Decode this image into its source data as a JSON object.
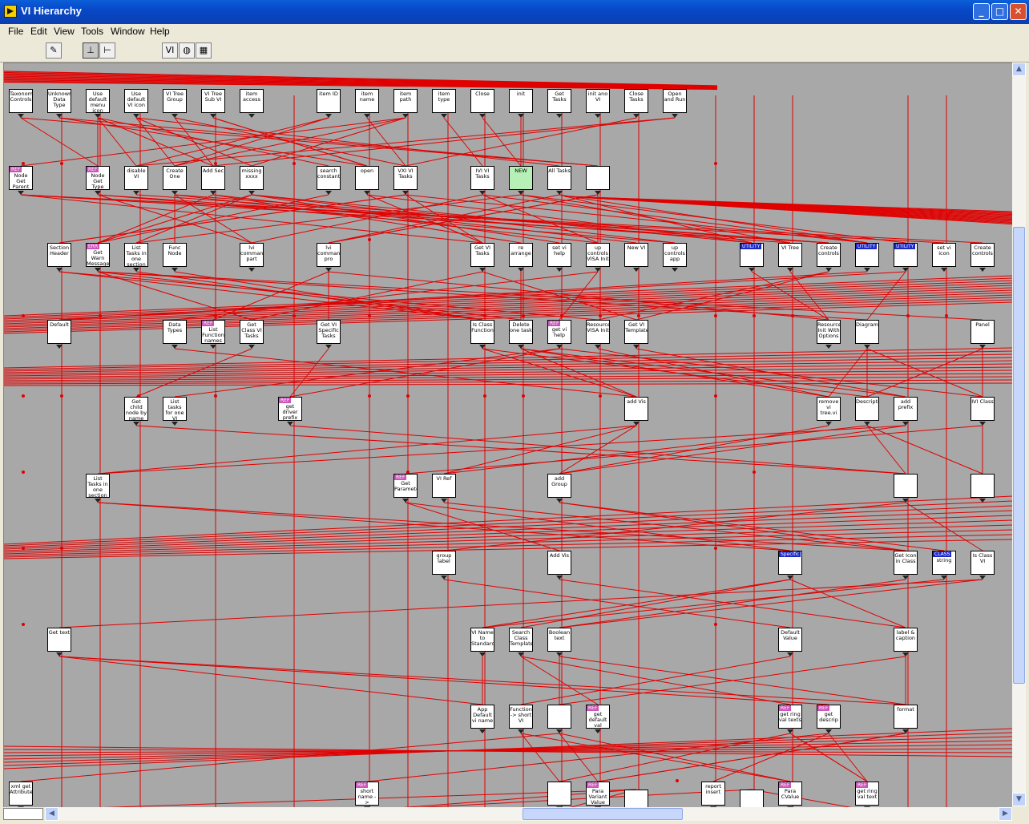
{
  "window": {
    "title": "VI Hierarchy"
  },
  "menu": [
    "File",
    "Edit",
    "View",
    "Tools",
    "Window",
    "Help"
  ],
  "toolbar": [
    {
      "icon": "pencil-icon",
      "glyph": "✎"
    },
    {
      "icon": "vertical-layout-icon",
      "glyph": "⊥"
    },
    {
      "icon": "horizontal-layout-icon",
      "glyph": "⊢"
    },
    {
      "icon": "vi-lib-icon",
      "glyph": "VI"
    },
    {
      "icon": "globe-icon",
      "glyph": "◍"
    },
    {
      "icon": "typedef-icon",
      "glyph": "▦"
    }
  ],
  "colors": {
    "wire": "#e00000",
    "canvas": "#a8a8a8"
  },
  "nodes": [
    {
      "label": "Taxonomy Controls"
    },
    {
      "label": "Unknown Data Type"
    },
    {
      "label": "Use default menu icon"
    },
    {
      "label": "Use default VI icon"
    },
    {
      "label": "VI Tree Group"
    },
    {
      "label": "VI Tree Sub VI"
    },
    {
      "label": "item access"
    },
    {
      "label": "item ID"
    },
    {
      "label": "item name"
    },
    {
      "label": "item path"
    },
    {
      "label": "item type"
    },
    {
      "label": "Close"
    },
    {
      "label": "init"
    },
    {
      "label": "Get Tasks"
    },
    {
      "label": "init ano VI"
    },
    {
      "label": "Close Tasks"
    },
    {
      "label": "Open and Run"
    },
    {
      "label": "Node Get Parent",
      "tag": "REF"
    },
    {
      "label": "Node Get Type",
      "tag": "REF"
    },
    {
      "label": "disable VI"
    },
    {
      "label": "Create One"
    },
    {
      "label": "Add Sec"
    },
    {
      "label": "missing xxxx"
    },
    {
      "label": "search constant"
    },
    {
      "label": "open"
    },
    {
      "label": "VXI VI Tasks"
    },
    {
      "label": "IVI VI Tasks"
    },
    {
      "label": "NEW"
    },
    {
      "label": "All Tasks"
    },
    {
      "label": ""
    },
    {
      "label": "Section Header"
    },
    {
      "label": "Get Warn Message",
      "tag": "ERR"
    },
    {
      "label": "List Tasks in one section"
    },
    {
      "label": "Func Node"
    },
    {
      "label": "lvi command part"
    },
    {
      "label": "lvi command pro"
    },
    {
      "label": "Get VI Tasks"
    },
    {
      "label": "re arrange"
    },
    {
      "label": "set vi help"
    },
    {
      "label": "up controls VISA Init"
    },
    {
      "label": "New VI"
    },
    {
      "label": "up controls app"
    },
    {
      "label": "",
      "tag": "UTILITY"
    },
    {
      "label": "VI Tree"
    },
    {
      "label": "Create controls"
    },
    {
      "label": "",
      "tag": "UTILITY"
    },
    {
      "label": "",
      "tag": "UTILITY"
    },
    {
      "label": "set vi icon"
    },
    {
      "label": "Create controls"
    },
    {
      "label": "Default"
    },
    {
      "label": "Data Types"
    },
    {
      "label": "List Function names",
      "tag": "REF"
    },
    {
      "label": "Get Class VI Tasks"
    },
    {
      "label": "Get VI Specific Tasks"
    },
    {
      "label": "Is Class Function"
    },
    {
      "label": "Delete one task"
    },
    {
      "label": "get vi help",
      "tag": "REF"
    },
    {
      "label": "Resource VISA Init"
    },
    {
      "label": "Get VI Template"
    },
    {
      "label": "Resource Init With Options"
    },
    {
      "label": "Diagram"
    },
    {
      "label": "Panel"
    },
    {
      "label": "Get child node by name"
    },
    {
      "label": "List tasks for one VI"
    },
    {
      "label": "get driver prefix",
      "tag": "REF"
    },
    {
      "label": "add Vis"
    },
    {
      "label": "remove vi tree.vi"
    },
    {
      "label": "Description"
    },
    {
      "label": "add prefix"
    },
    {
      "label": "IVI Class"
    },
    {
      "label": "List Tasks in one section"
    },
    {
      "label": "Get Parameter",
      "tag": "REF"
    },
    {
      "label": "VI Ref"
    },
    {
      "label": "add Group"
    },
    {
      "label": ""
    },
    {
      "label": ""
    },
    {
      "label": "group label"
    },
    {
      "label": "Add Vis"
    },
    {
      "label": "",
      "tag": "Specific"
    },
    {
      "label": "Get Icon in Class"
    },
    {
      "label": "string",
      "tag": "CLASS"
    },
    {
      "label": "Is Class VI"
    },
    {
      "label": "Get text"
    },
    {
      "label": "VI Name to Standard"
    },
    {
      "label": "Search Class Template"
    },
    {
      "label": "Boolean text"
    },
    {
      "label": "Default Value"
    },
    {
      "label": "label & caption"
    },
    {
      "label": "App Default vi name"
    },
    {
      "label": "Function -> short VI"
    },
    {
      "label": ""
    },
    {
      "label": "get default val",
      "tag": "REF"
    },
    {
      "label": "get ring val texts",
      "tag": "REF"
    },
    {
      "label": "get descrip",
      "tag": "REF"
    },
    {
      "label": "format"
    },
    {
      "label": "xml get Attribute"
    },
    {
      "label": "short name -> handle",
      "tag": "REF"
    },
    {
      "label": ""
    },
    {
      "label": "Para Variant Value",
      "tag": "REF"
    },
    {
      "label": ""
    },
    {
      "label": "report insert"
    },
    {
      "label": ""
    },
    {
      "label": "Para CValue",
      "tag": "REF"
    },
    {
      "label": "get ring val text",
      "tag": "REF"
    }
  ]
}
